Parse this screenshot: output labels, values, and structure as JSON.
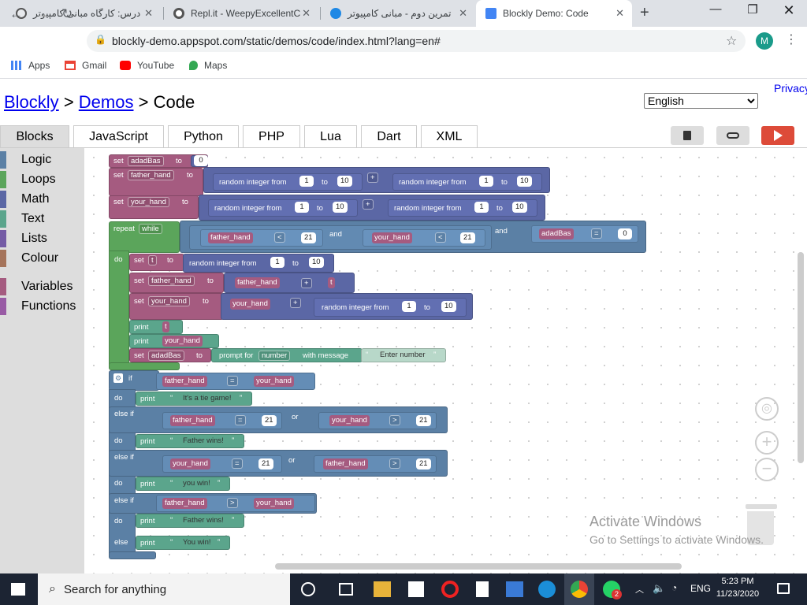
{
  "browser": {
    "tabs": [
      {
        "title": "درس: کارگاه مبانی کامپیوتر"
      },
      {
        "title": "Repl.it - WeepyExcellentC"
      },
      {
        "title": "تمرین دوم - مبانی کامپیوتر"
      },
      {
        "title": "Blockly Demo: Code"
      }
    ],
    "url": "blockly-demo.appspot.com/static/demos/code/index.html?lang=en#",
    "avatar": "M",
    "bookmarks": [
      "Apps",
      "Gmail",
      "YouTube",
      "Maps"
    ]
  },
  "page": {
    "crumb_blockly": "Blockly",
    "crumb_sep1": ">",
    "crumb_demos": "Demos",
    "crumb_sep2": ">",
    "crumb_code": "Code",
    "privacy": "Privacy",
    "language": "English",
    "tabs": [
      "Blocks",
      "JavaScript",
      "Python",
      "PHP",
      "Lua",
      "Dart",
      "XML"
    ]
  },
  "toolbox": {
    "categories": [
      {
        "label": "Logic",
        "color": "#5b80a5"
      },
      {
        "label": "Loops",
        "color": "#5ba55b"
      },
      {
        "label": "Math",
        "color": "#5b67a5"
      },
      {
        "label": "Text",
        "color": "#5ba58c"
      },
      {
        "label": "Lists",
        "color": "#745ba5"
      },
      {
        "label": "Colour",
        "color": "#a5745b"
      },
      {
        "label": "Variables",
        "color": "#a55b80"
      },
      {
        "label": "Functions",
        "color": "#995ba5"
      }
    ]
  },
  "kw": {
    "set": "set",
    "to": "to",
    "rif": "random integer from",
    "repeat": "repeat",
    "while": "while",
    "do": "do",
    "and": "and",
    "or": "or",
    "print": "print",
    "prompt_for": "prompt for",
    "number": "number",
    "with_message": "with message",
    "if": "if",
    "else_if": "else if",
    "else": "else",
    "lt": "<",
    "gt": ">",
    "eq": "=",
    "plus": "+",
    "quote_open": "“",
    "quote_close": "”"
  },
  "vars": {
    "adadBas": "adadBas",
    "father_hand": "father_hand",
    "your_hand": "your_hand",
    "t": "t"
  },
  "nums": {
    "n0": "0",
    "n1": "1",
    "n10": "10",
    "n21": "21"
  },
  "strings": {
    "enter": "Enter number",
    "tie": "It's a tie game!",
    "father": "Father wins!",
    "you": "you win!",
    "you2": "You win!"
  },
  "watermark": {
    "line1": "Activate Windows",
    "line2": "Go to Settings to activate Windows."
  },
  "taskbar": {
    "search": "Search for anything",
    "lang": "ENG",
    "time": "5:23 PM",
    "date": "11/23/2020",
    "badge_whatsapp": "2"
  }
}
